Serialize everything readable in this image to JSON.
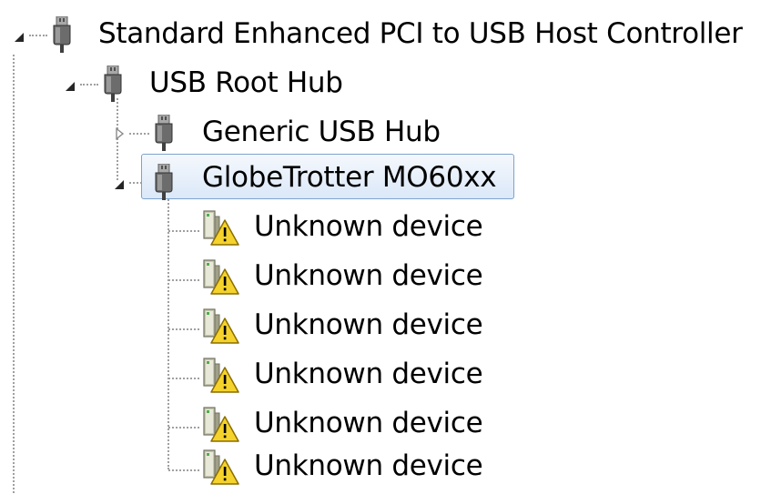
{
  "tree": {
    "controller": {
      "label": "Standard Enhanced PCI to USB Host Controller",
      "expanded": true,
      "icon": "usb-plug-icon"
    },
    "root_hub": {
      "label": "USB Root Hub",
      "expanded": true,
      "icon": "usb-plug-icon"
    },
    "generic_hub": {
      "label": "Generic USB Hub",
      "expanded": false,
      "icon": "usb-plug-icon"
    },
    "globetrotter": {
      "label": "GlobeTrotter MO60xx",
      "expanded": true,
      "selected": true,
      "icon": "usb-plug-icon"
    },
    "unknown_devices": [
      {
        "label": "Unknown device",
        "icon": "device-warning-icon"
      },
      {
        "label": "Unknown device",
        "icon": "device-warning-icon"
      },
      {
        "label": "Unknown device",
        "icon": "device-warning-icon"
      },
      {
        "label": "Unknown device",
        "icon": "device-warning-icon"
      },
      {
        "label": "Unknown device",
        "icon": "device-warning-icon"
      },
      {
        "label": "Unknown device",
        "icon": "device-warning-icon"
      }
    ]
  },
  "colors": {
    "selection_border": "#7da2ce",
    "selection_fill": "#dbe8f8",
    "warning": "#f5d32c",
    "guide_line": "#a0a0a0"
  }
}
